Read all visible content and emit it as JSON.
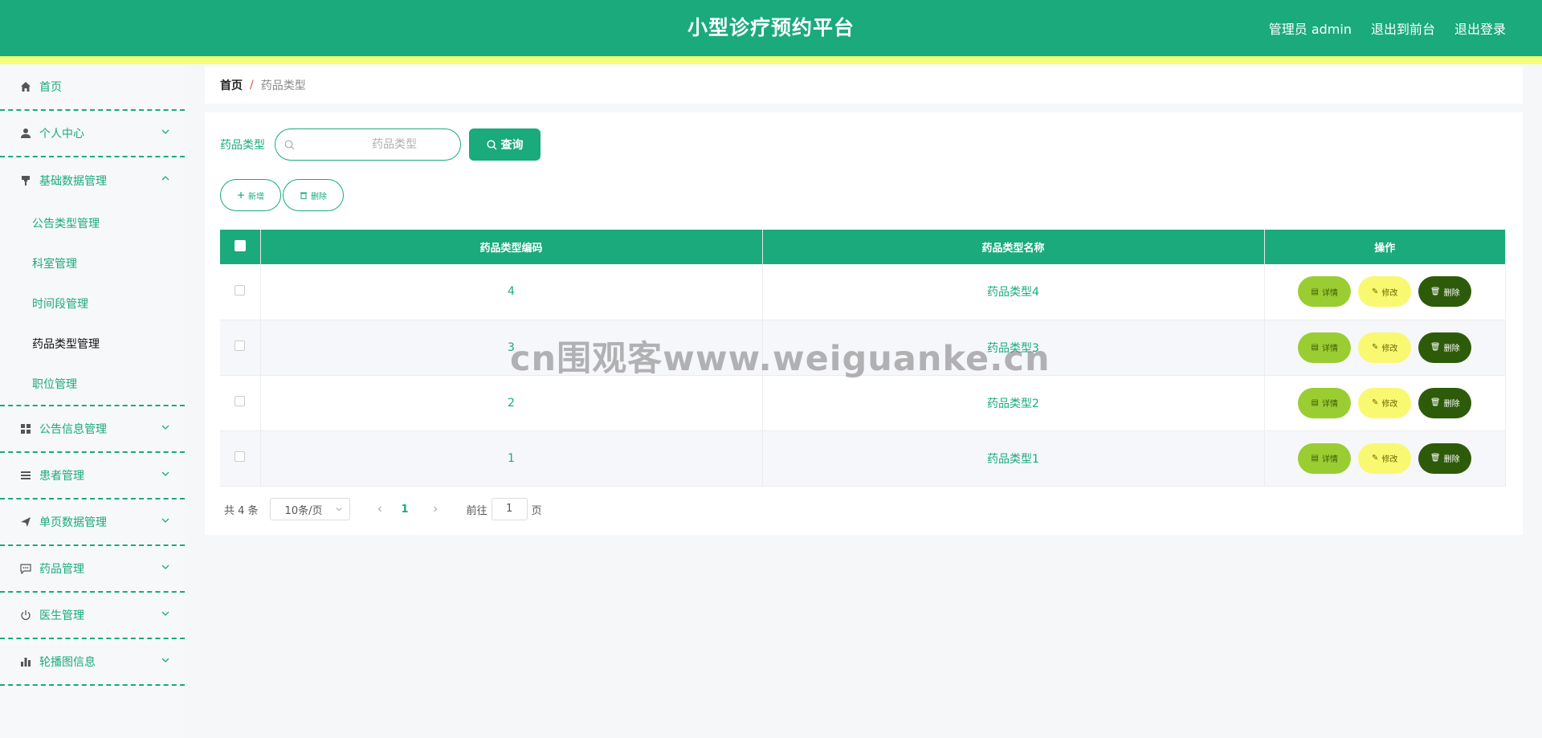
{
  "header": {
    "title": "小型诊疗预约平台",
    "user": "管理员 admin",
    "to_front": "退出到前台",
    "logout": "退出登录"
  },
  "sidebar": {
    "home": "首页",
    "personal": "个人中心",
    "basic": "基础数据管理",
    "basic_sub": [
      "公告类型管理",
      "科室管理",
      "时间段管理",
      "药品类型管理",
      "职位管理"
    ],
    "notice": "公告信息管理",
    "patient": "患者管理",
    "singlepage": "单页数据管理",
    "drug": "药品管理",
    "doctor": "医生管理",
    "carousel": "轮播图信息"
  },
  "breadcrumb": {
    "home": "首页",
    "sep": "/",
    "current": "药品类型"
  },
  "search": {
    "label": "药品类型",
    "placeholder": "药品类型",
    "button": "查询"
  },
  "actions": {
    "add": "新增",
    "delete": "删除"
  },
  "table": {
    "headers": [
      "药品类型编码",
      "药品类型名称",
      "操作"
    ],
    "rows": [
      {
        "code": "4",
        "name": "药品类型4"
      },
      {
        "code": "3",
        "name": "药品类型3"
      },
      {
        "code": "2",
        "name": "药品类型2"
      },
      {
        "code": "1",
        "name": "药品类型1"
      }
    ],
    "ops": {
      "detail": "详情",
      "edit": "修改",
      "delete": "删除"
    }
  },
  "pager": {
    "total": "共 4 条",
    "size": "10条/页",
    "page": "1",
    "goto": "前往",
    "goto_value": "1",
    "unit": "页"
  },
  "watermark": "cn围观客www.weiguanke.cn",
  "colors": {
    "primary": "#1aaa7b",
    "accent_bar": "#f4ff7a",
    "detail": "#9acd32",
    "edit": "#f9f871",
    "delete": "#2e5b0a"
  }
}
